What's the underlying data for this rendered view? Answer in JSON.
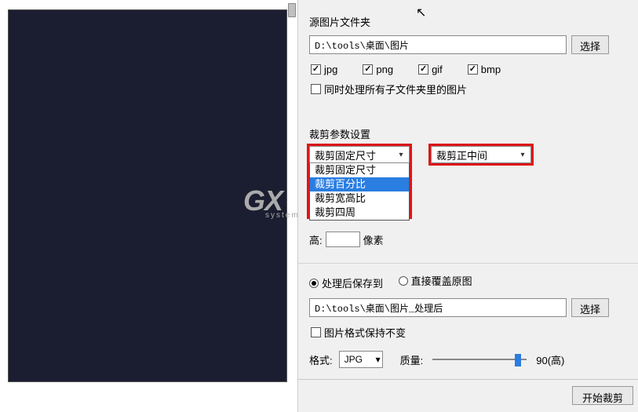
{
  "source": {
    "label": "源图片文件夹",
    "path": "D:\\tools\\桌面\\图片",
    "browse": "选择",
    "formats": {
      "jpg": {
        "label": "jpg",
        "checked": true
      },
      "png": {
        "label": "png",
        "checked": true
      },
      "gif": {
        "label": "gif",
        "checked": true
      },
      "bmp": {
        "label": "bmp",
        "checked": true
      }
    },
    "recurse": {
      "label": "同时处理所有子文件夹里的图片",
      "checked": false
    }
  },
  "crop": {
    "label": "裁剪参数设置",
    "mode_selected": "裁剪固定尺寸",
    "mode_options": [
      "裁剪固定尺寸",
      "裁剪百分比",
      "裁剪宽高比",
      "裁剪四周"
    ],
    "mode_highlight_index": 1,
    "position_selected": "裁剪正中间",
    "height_label": "高:",
    "height_unit": "像素"
  },
  "output": {
    "save_to": {
      "label": "处理后保存到",
      "checked": true
    },
    "overwrite": {
      "label": "直接覆盖原图",
      "checked": false
    },
    "path": "D:\\tools\\桌面\\图片_处理后",
    "browse": "选择",
    "keep_format": {
      "label": "图片格式保持不变",
      "checked": false
    },
    "format_label": "格式:",
    "format_value": "JPG",
    "quality_label": "质量:",
    "quality_value": "90(高)"
  },
  "action": {
    "start": "开始裁剪"
  }
}
